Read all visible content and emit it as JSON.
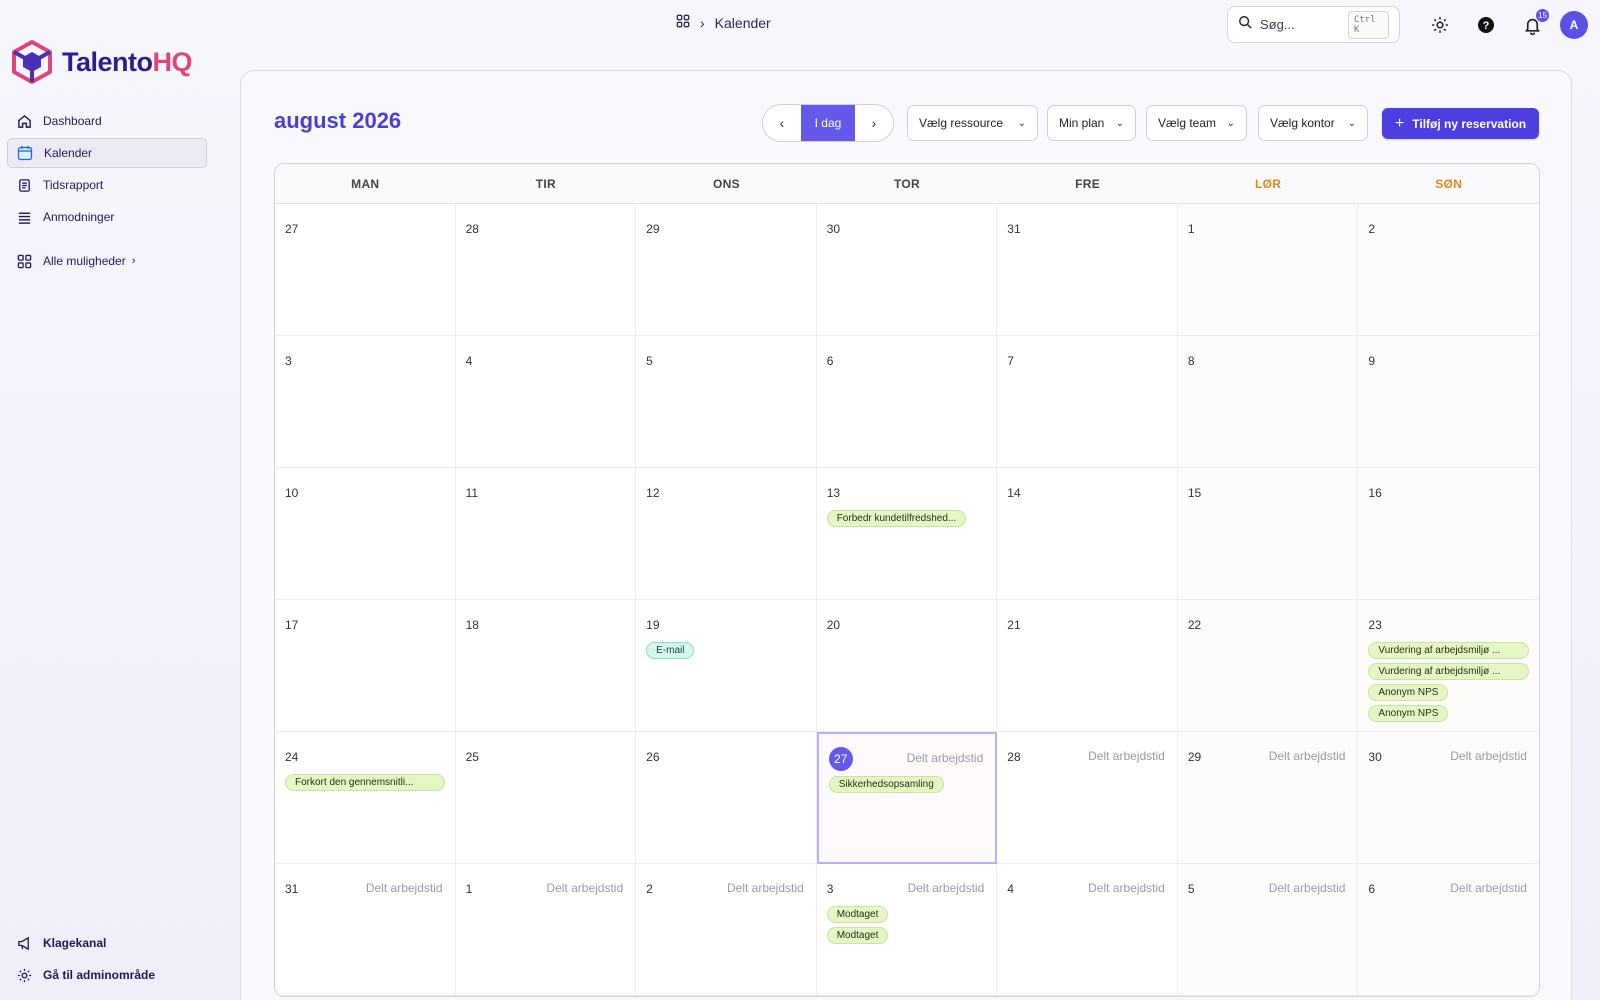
{
  "app": {
    "logo_main": "Talento",
    "logo_accent": "HQ"
  },
  "breadcrumb": {
    "current": "Kalender"
  },
  "search": {
    "placeholder": "Søg...",
    "shortcut": "Ctrl K"
  },
  "notifications": {
    "count": "15"
  },
  "user": {
    "initial": "A"
  },
  "sidebar": {
    "items": [
      {
        "label": "Dashboard",
        "icon": "home-icon"
      },
      {
        "label": "Kalender",
        "icon": "calendar-icon",
        "active": true
      },
      {
        "label": "Tidsrapport",
        "icon": "report-icon"
      },
      {
        "label": "Anmodninger",
        "icon": "list-icon"
      }
    ],
    "more_label": "Alle muligheder",
    "bottom": [
      {
        "label": "Klagekanal",
        "icon": "megaphone-icon"
      },
      {
        "label": "Gå til adminområde",
        "icon": "gear-icon"
      }
    ]
  },
  "calendar": {
    "title": "august 2026",
    "today_label": "I dag",
    "filters": {
      "resource": "Vælg ressource",
      "plan": "Min plan",
      "team": "Vælg team",
      "office": "Vælg kontor"
    },
    "add_label": "Tilføj ny reservation",
    "weekdays": [
      "MAN",
      "TIR",
      "ONS",
      "TOR",
      "FRE",
      "LØR",
      "SØN"
    ],
    "shared_label": "Delt arbejdstid",
    "days": [
      {
        "n": "27"
      },
      {
        "n": "28"
      },
      {
        "n": "29"
      },
      {
        "n": "30"
      },
      {
        "n": "31"
      },
      {
        "n": "1"
      },
      {
        "n": "2"
      },
      {
        "n": "3"
      },
      {
        "n": "4"
      },
      {
        "n": "5"
      },
      {
        "n": "6"
      },
      {
        "n": "7"
      },
      {
        "n": "8"
      },
      {
        "n": "9"
      },
      {
        "n": "10"
      },
      {
        "n": "11"
      },
      {
        "n": "12"
      },
      {
        "n": "13",
        "events": [
          {
            "t": "Forbedr kundetilfredshed...",
            "c": "green"
          }
        ]
      },
      {
        "n": "14"
      },
      {
        "n": "15"
      },
      {
        "n": "16"
      },
      {
        "n": "17"
      },
      {
        "n": "18"
      },
      {
        "n": "19",
        "events": [
          {
            "t": "E-mail",
            "c": "teal"
          }
        ]
      },
      {
        "n": "20"
      },
      {
        "n": "21"
      },
      {
        "n": "22"
      },
      {
        "n": "23",
        "events": [
          {
            "t": "Vurdering af arbejdsmiljø ...",
            "c": "green",
            "full": true
          },
          {
            "t": "Vurdering af arbejdsmiljø ...",
            "c": "green",
            "full": true
          },
          {
            "t": "Anonym NPS",
            "c": "green"
          },
          {
            "t": "Anonym NPS",
            "c": "green"
          }
        ]
      },
      {
        "n": "24",
        "events": [
          {
            "t": "Forkort den gennemsnitli...",
            "c": "green",
            "full": true
          }
        ]
      },
      {
        "n": "25"
      },
      {
        "n": "26"
      },
      {
        "n": "27",
        "today": true,
        "shared": true,
        "events": [
          {
            "t": "Sikkerhedsopsamling",
            "c": "green"
          }
        ]
      },
      {
        "n": "28",
        "shared": true
      },
      {
        "n": "29",
        "shared": true
      },
      {
        "n": "30",
        "shared": true
      },
      {
        "n": "31",
        "shared": true
      },
      {
        "n": "1",
        "shared": true
      },
      {
        "n": "2",
        "shared": true
      },
      {
        "n": "3",
        "shared": true,
        "events": [
          {
            "t": "Modtaget",
            "c": "green"
          },
          {
            "t": "Modtaget",
            "c": "green"
          }
        ]
      },
      {
        "n": "4",
        "shared": true
      },
      {
        "n": "5",
        "shared": true
      },
      {
        "n": "6",
        "shared": true
      }
    ]
  },
  "colors": {
    "accent": "#6459ea",
    "brand": "#2b1f8f",
    "brand_accent": "#e0457b",
    "weekend": "#d98c1c"
  }
}
